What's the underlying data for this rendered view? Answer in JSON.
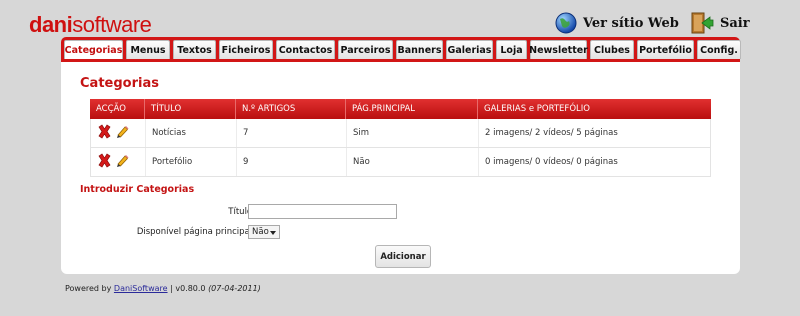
{
  "brand": {
    "part1": "dani",
    "part2": "software"
  },
  "toplinks": {
    "site": "Ver sítio Web",
    "exit": "Sair"
  },
  "tabs": [
    "Categorias",
    "Menus",
    "Textos",
    "Ficheiros",
    "Contactos",
    "Parceiros",
    "Banners",
    "Galerias",
    "Loja",
    "Newsletter",
    "Clubes",
    "Portefólio",
    "Config."
  ],
  "active_tab": "Categorias",
  "main": {
    "heading": "Categorias",
    "columns": [
      "ACÇÃO",
      "TÍTULO",
      "N.º ARTIGOS",
      "PÁG.PRINCIPAL",
      "GALERIAS e PORTEFÓLIO"
    ],
    "rows": [
      {
        "title": "Notícias",
        "articles": "7",
        "main_page": "Sim",
        "galleries": "2 imagens/ 2 vídeos/ 5 páginas"
      },
      {
        "title": "Portefólio",
        "articles": "9",
        "main_page": "Não",
        "galleries": "0 imagens/ 0 vídeos/ 0 páginas"
      }
    ]
  },
  "form": {
    "heading": "Introduzir Categorias",
    "title_label": "Título:",
    "title_value": "",
    "main_label": "Disponível página principal:",
    "main_value": "Não",
    "submit": "Adicionar"
  },
  "footer": {
    "prefix": "Powered by ",
    "link": "DaniSoftware",
    "version": " | v0.80.0 ",
    "date": "(07-04-2011)"
  },
  "colors": {
    "brand_red": "#cf1010",
    "background": "#d7d7d7"
  }
}
